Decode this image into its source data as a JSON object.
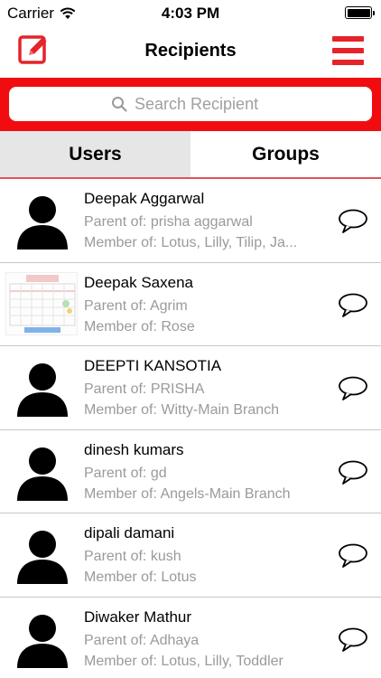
{
  "status_bar": {
    "carrier": "Carrier",
    "time": "4:03 PM",
    "icons": [
      "wifi-icon",
      "battery-icon"
    ]
  },
  "nav": {
    "title": "Recipients",
    "left_icon": "compose-icon",
    "right_icon": "hamburger-menu-icon"
  },
  "search": {
    "placeholder": "Search Recipient",
    "value": ""
  },
  "tabs": [
    {
      "label": "Users",
      "selected": true
    },
    {
      "label": "Groups",
      "selected": false
    }
  ],
  "colors": {
    "accent": "#f10d0f",
    "icon_red": "#e4242a",
    "tab_active": "#e6e6e6",
    "secondary_text": "#9a9a9a"
  },
  "recipients": [
    {
      "name": "Deepak Aggarwal",
      "parent": "Parent of: prisha aggarwal",
      "member": "Member of: Lotus, Lilly, Tilip, Ja...",
      "avatar": "person-silhouette"
    },
    {
      "name": "Deepak Saxena",
      "parent": "Parent of: Agrim",
      "member": "Member of: Rose",
      "avatar": "photo",
      "avatar_caption": "Happy New Year"
    },
    {
      "name": "DEEPTI KANSOTIA",
      "parent": "Parent of: PRISHA",
      "member": "Member of: Witty-Main Branch",
      "avatar": "person-silhouette"
    },
    {
      "name": "dinesh kumars",
      "parent": "Parent of: gd",
      "member": "Member of: Angels-Main Branch",
      "avatar": "person-silhouette"
    },
    {
      "name": "dipali damani",
      "parent": "Parent of: kush",
      "member": "Member of: Lotus",
      "avatar": "person-silhouette"
    },
    {
      "name": "Diwaker Mathur",
      "parent": "Parent of: Adhaya",
      "member": "Member of: Lotus, Lilly, Toddler",
      "avatar": "person-silhouette"
    }
  ]
}
